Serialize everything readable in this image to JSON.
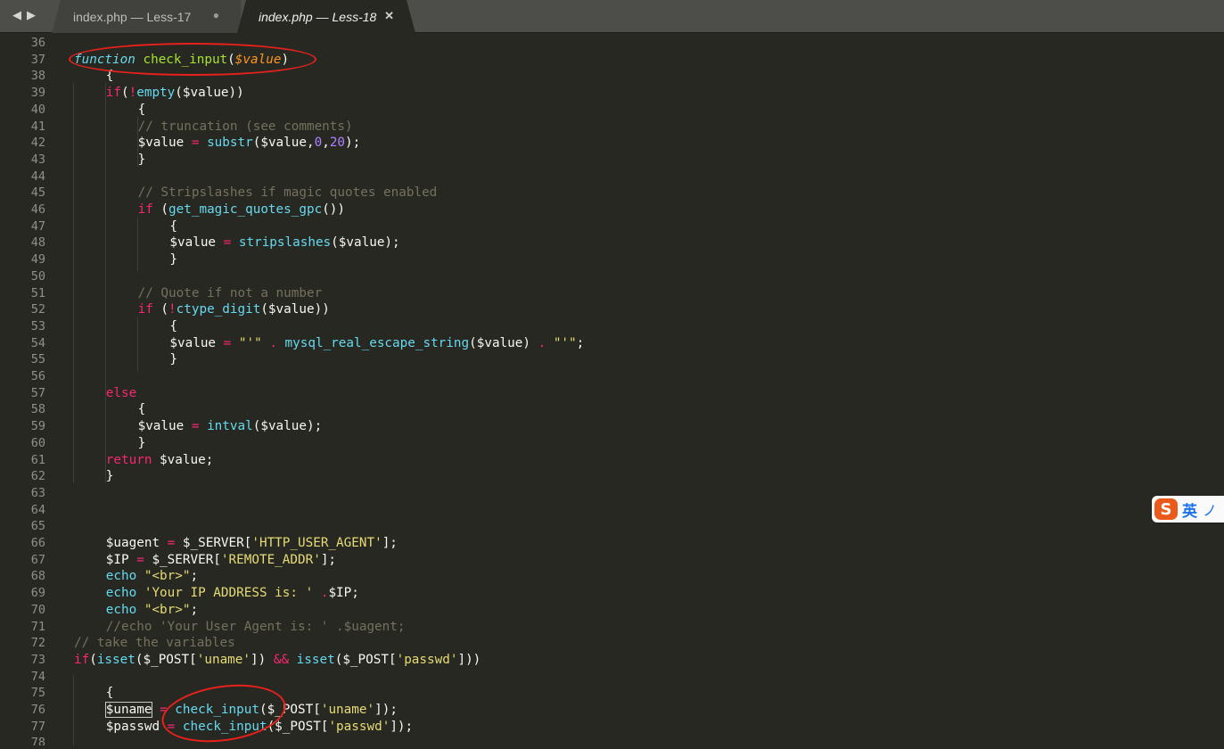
{
  "window": {
    "nav_back_icon": "◀",
    "nav_forward_icon": "▶",
    "tabs": [
      {
        "label": "index.php — Less-17",
        "state": "modified",
        "indicator": "●"
      },
      {
        "label": "index.php — Less-18",
        "state": "active",
        "indicator": "✕"
      }
    ]
  },
  "theme": {
    "background": "#272822",
    "keyword": "#f92672",
    "support": "#66d9ef",
    "name": "#a6e22e",
    "parameter": "#fd971f",
    "string": "#e6db74",
    "number": "#ae81ff",
    "comment": "#75715e",
    "annotation": "#e8211c"
  },
  "editor": {
    "lines": [
      {
        "n": "36",
        "indent": 0,
        "tokens": []
      },
      {
        "n": "37",
        "indent": 0,
        "tokens": [
          [
            "sp",
            "function"
          ],
          [
            "txt",
            " "
          ],
          [
            "name",
            "check_input"
          ],
          [
            "txt",
            "("
          ],
          [
            "par",
            "$value"
          ],
          [
            "txt",
            ")"
          ]
        ]
      },
      {
        "n": "38",
        "indent": 4,
        "tokens": [
          [
            "txt",
            "{"
          ]
        ]
      },
      {
        "n": "39",
        "indent": 4,
        "tokens": [
          [
            "kw",
            "if"
          ],
          [
            "txt",
            "("
          ],
          [
            "op",
            "!"
          ],
          [
            "fn",
            "empty"
          ],
          [
            "txt",
            "($value))"
          ]
        ]
      },
      {
        "n": "40",
        "indent": 8,
        "tokens": [
          [
            "txt",
            "{"
          ]
        ]
      },
      {
        "n": "41",
        "indent": 8,
        "tokens": [
          [
            "cm",
            "// truncation (see comments)"
          ]
        ]
      },
      {
        "n": "42",
        "indent": 8,
        "tokens": [
          [
            "txt",
            "$value "
          ],
          [
            "op",
            "="
          ],
          [
            "txt",
            " "
          ],
          [
            "fn",
            "substr"
          ],
          [
            "txt",
            "($value,"
          ],
          [
            "num",
            "0"
          ],
          [
            "txt",
            ","
          ],
          [
            "num",
            "20"
          ],
          [
            "txt",
            ");"
          ]
        ]
      },
      {
        "n": "43",
        "indent": 8,
        "tokens": [
          [
            "txt",
            "}"
          ]
        ]
      },
      {
        "n": "44",
        "indent": 0,
        "tokens": []
      },
      {
        "n": "45",
        "indent": 8,
        "tokens": [
          [
            "cm",
            "// Stripslashes if magic quotes enabled"
          ]
        ]
      },
      {
        "n": "46",
        "indent": 8,
        "tokens": [
          [
            "kw",
            "if"
          ],
          [
            "txt",
            " ("
          ],
          [
            "fn",
            "get_magic_quotes_gpc"
          ],
          [
            "txt",
            "())"
          ]
        ]
      },
      {
        "n": "47",
        "indent": 12,
        "tokens": [
          [
            "txt",
            "{"
          ]
        ]
      },
      {
        "n": "48",
        "indent": 12,
        "tokens": [
          [
            "txt",
            "$value "
          ],
          [
            "op",
            "="
          ],
          [
            "txt",
            " "
          ],
          [
            "fn",
            "stripslashes"
          ],
          [
            "txt",
            "($value);"
          ]
        ]
      },
      {
        "n": "49",
        "indent": 12,
        "tokens": [
          [
            "txt",
            "}"
          ]
        ]
      },
      {
        "n": "50",
        "indent": 0,
        "tokens": []
      },
      {
        "n": "51",
        "indent": 8,
        "tokens": [
          [
            "cm",
            "// Quote if not a number"
          ]
        ]
      },
      {
        "n": "52",
        "indent": 8,
        "tokens": [
          [
            "kw",
            "if"
          ],
          [
            "txt",
            " ("
          ],
          [
            "op",
            "!"
          ],
          [
            "fn",
            "ctype_digit"
          ],
          [
            "txt",
            "($value))"
          ]
        ]
      },
      {
        "n": "53",
        "indent": 12,
        "tokens": [
          [
            "txt",
            "{"
          ]
        ]
      },
      {
        "n": "54",
        "indent": 12,
        "tokens": [
          [
            "txt",
            "$value "
          ],
          [
            "op",
            "="
          ],
          [
            "txt",
            " "
          ],
          [
            "str",
            "\"'\""
          ],
          [
            "txt",
            " "
          ],
          [
            "op",
            "."
          ],
          [
            "txt",
            " "
          ],
          [
            "fn",
            "mysql_real_escape_string"
          ],
          [
            "txt",
            "($value) "
          ],
          [
            "op",
            "."
          ],
          [
            "txt",
            " "
          ],
          [
            "str",
            "\"'\""
          ],
          [
            "txt",
            ";"
          ]
        ]
      },
      {
        "n": "55",
        "indent": 12,
        "tokens": [
          [
            "txt",
            "}"
          ]
        ]
      },
      {
        "n": "56",
        "indent": 0,
        "tokens": []
      },
      {
        "n": "57",
        "indent": 4,
        "tokens": [
          [
            "kw",
            "else"
          ]
        ]
      },
      {
        "n": "58",
        "indent": 8,
        "tokens": [
          [
            "txt",
            "{"
          ]
        ]
      },
      {
        "n": "59",
        "indent": 8,
        "tokens": [
          [
            "txt",
            "$value "
          ],
          [
            "op",
            "="
          ],
          [
            "txt",
            " "
          ],
          [
            "fn",
            "intval"
          ],
          [
            "txt",
            "($value);"
          ]
        ]
      },
      {
        "n": "60",
        "indent": 8,
        "tokens": [
          [
            "txt",
            "}"
          ]
        ]
      },
      {
        "n": "61",
        "indent": 4,
        "tokens": [
          [
            "kw",
            "return"
          ],
          [
            "txt",
            " $value;"
          ]
        ]
      },
      {
        "n": "62",
        "indent": 4,
        "tokens": [
          [
            "txt",
            "}"
          ]
        ]
      },
      {
        "n": "63",
        "indent": 0,
        "tokens": []
      },
      {
        "n": "64",
        "indent": 0,
        "tokens": []
      },
      {
        "n": "65",
        "indent": 0,
        "tokens": []
      },
      {
        "n": "66",
        "indent": 4,
        "tokens": [
          [
            "txt",
            "$uagent "
          ],
          [
            "op",
            "="
          ],
          [
            "txt",
            " $_SERVER["
          ],
          [
            "str",
            "'HTTP_USER_AGENT'"
          ],
          [
            "txt",
            "];"
          ]
        ]
      },
      {
        "n": "67",
        "indent": 4,
        "tokens": [
          [
            "txt",
            "$IP "
          ],
          [
            "op",
            "="
          ],
          [
            "txt",
            " $_SERVER["
          ],
          [
            "str",
            "'REMOTE_ADDR'"
          ],
          [
            "txt",
            "];"
          ]
        ]
      },
      {
        "n": "68",
        "indent": 4,
        "tokens": [
          [
            "fn",
            "echo"
          ],
          [
            "txt",
            " "
          ],
          [
            "str",
            "\"<br>\""
          ],
          [
            "txt",
            ";"
          ]
        ]
      },
      {
        "n": "69",
        "indent": 4,
        "tokens": [
          [
            "fn",
            "echo"
          ],
          [
            "txt",
            " "
          ],
          [
            "str",
            "'Your IP ADDRESS is: '"
          ],
          [
            "txt",
            " "
          ],
          [
            "op",
            "."
          ],
          [
            "txt",
            "$IP;"
          ]
        ]
      },
      {
        "n": "70",
        "indent": 4,
        "tokens": [
          [
            "fn",
            "echo"
          ],
          [
            "txt",
            " "
          ],
          [
            "str",
            "\"<br>\""
          ],
          [
            "txt",
            ";"
          ]
        ]
      },
      {
        "n": "71",
        "indent": 4,
        "tokens": [
          [
            "cm",
            "//echo 'Your User Agent is: ' .$uagent;"
          ]
        ]
      },
      {
        "n": "72",
        "indent": 0,
        "tokens": [
          [
            "cm",
            "// take the variables"
          ]
        ]
      },
      {
        "n": "73",
        "indent": 0,
        "tokens": [
          [
            "kw",
            "if"
          ],
          [
            "txt",
            "("
          ],
          [
            "fn",
            "isset"
          ],
          [
            "txt",
            "($_POST["
          ],
          [
            "str",
            "'uname'"
          ],
          [
            "txt",
            "]) "
          ],
          [
            "op",
            "&&"
          ],
          [
            "txt",
            " "
          ],
          [
            "fn",
            "isset"
          ],
          [
            "txt",
            "($_POST["
          ],
          [
            "str",
            "'passwd'"
          ],
          [
            "txt",
            "]))"
          ]
        ]
      },
      {
        "n": "74",
        "indent": 0,
        "tokens": []
      },
      {
        "n": "75",
        "indent": 4,
        "tokens": [
          [
            "txt",
            "{"
          ]
        ]
      },
      {
        "n": "76",
        "indent": 4,
        "tokens": [
          [
            "box",
            "$uname"
          ],
          [
            "txt",
            " "
          ],
          [
            "op",
            "="
          ],
          [
            "txt",
            " "
          ],
          [
            "fn",
            "check_input"
          ],
          [
            "txt",
            "($_POST["
          ],
          [
            "str",
            "'uname'"
          ],
          [
            "txt",
            "]);"
          ]
        ]
      },
      {
        "n": "77",
        "indent": 4,
        "tokens": [
          [
            "txt",
            "$passwd "
          ],
          [
            "op",
            "="
          ],
          [
            "txt",
            " "
          ],
          [
            "fn",
            "check_input"
          ],
          [
            "txt",
            "($_POST["
          ],
          [
            "str",
            "'passwd'"
          ],
          [
            "txt",
            "]);"
          ]
        ]
      },
      {
        "n": "78",
        "indent": 0,
        "tokens": []
      }
    ]
  },
  "ime": {
    "logo": "S",
    "language": "英",
    "extra": "ノ"
  }
}
